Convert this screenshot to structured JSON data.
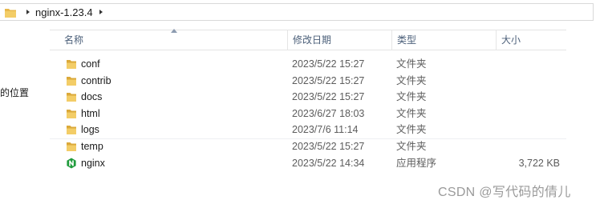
{
  "address_bar": {
    "path_segment": "nginx-1.23.4"
  },
  "nav_pane": {
    "partial_label": "的位置"
  },
  "columns": {
    "name": "名称",
    "date": "修改日期",
    "type": "类型",
    "size": "大小"
  },
  "rows": [
    {
      "name": "conf",
      "date": "2023/5/22 15:27",
      "type": "文件夹",
      "size": "",
      "icon": "folder-icon"
    },
    {
      "name": "contrib",
      "date": "2023/5/22 15:27",
      "type": "文件夹",
      "size": "",
      "icon": "folder-icon"
    },
    {
      "name": "docs",
      "date": "2023/5/22 15:27",
      "type": "文件夹",
      "size": "",
      "icon": "folder-icon"
    },
    {
      "name": "html",
      "date": "2023/6/27 18:03",
      "type": "文件夹",
      "size": "",
      "icon": "folder-icon"
    },
    {
      "name": "logs",
      "date": "2023/7/6 11:14",
      "type": "文件夹",
      "size": "",
      "icon": "folder-icon"
    },
    {
      "name": "temp",
      "date": "2023/5/22 15:27",
      "type": "文件夹",
      "size": "",
      "icon": "folder-icon"
    },
    {
      "name": "nginx",
      "date": "2023/5/22 14:34",
      "type": "应用程序",
      "size": "3,722 KB",
      "icon": "nginx-app-icon"
    }
  ],
  "watermark": "CSDN @写代码的倩儿",
  "colors": {
    "folder": "#e8b84a",
    "header_text": "#4c607a",
    "nginx_green": "#1f9b3b"
  }
}
